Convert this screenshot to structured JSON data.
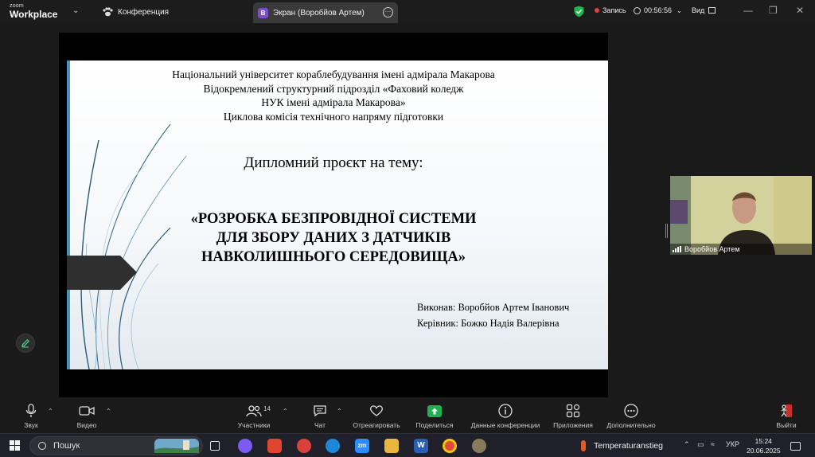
{
  "titlebar": {
    "logo_top": "zoom",
    "logo_bottom": "Workplace",
    "meeting_tab_label": "Конференция",
    "screen_tab_badge": "В",
    "screen_tab_label": "Экран (Воробйов Артем)",
    "recording_label": "Запись",
    "elapsed_time": "00:56:56",
    "view_label": "Вид"
  },
  "slide": {
    "header_lines": [
      "Національний університет кораблебудування  імені адмірала Макарова",
      "Відокремлений структурний підрозділ «Фаховий коледж",
      "НУК імені адмірала Макарова»",
      "Циклова комісія  технічного напряму підготовки"
    ],
    "project_title": "Дипломний проєкт на тему:",
    "topic_lines": [
      "«РОЗРОБКА БЕЗПРОВІДНОЇ СИСТЕМИ",
      "ДЛЯ ЗБОРУ ДАНИХ З ДАТЧИКІВ",
      "НАВКОЛИШНЬОГО СЕРЕДОВИЩА»"
    ],
    "author_line": "Виконав: Воробйов Артем Іванович",
    "supervisor_line": "Керівник: Божко Надія Валерівна"
  },
  "video": {
    "participant_name": "Воробйов Артем"
  },
  "toolbar": {
    "audio_label": "Звук",
    "video_label": "Видео",
    "participants_label": "Участники",
    "participants_count": "14",
    "chat_label": "Чат",
    "react_label": "Отреагировать",
    "share_label": "Поделиться",
    "info_label": "Данные конференции",
    "apps_label": "Приложения",
    "more_label": "Дополнительно",
    "leave_label": "Выйти"
  },
  "taskbar": {
    "search_placeholder": "Пошук",
    "weather_label": "Temperaturanstieg",
    "language": "УКР",
    "time": "15:24",
    "date": "20.06.2025"
  },
  "colors": {
    "background": "#1a1a1a",
    "share_green": "#1fb14f",
    "recording_red": "#e0443c",
    "badge_purple": "#7b4fc9",
    "slide_arrow": "#2f2f2f"
  }
}
